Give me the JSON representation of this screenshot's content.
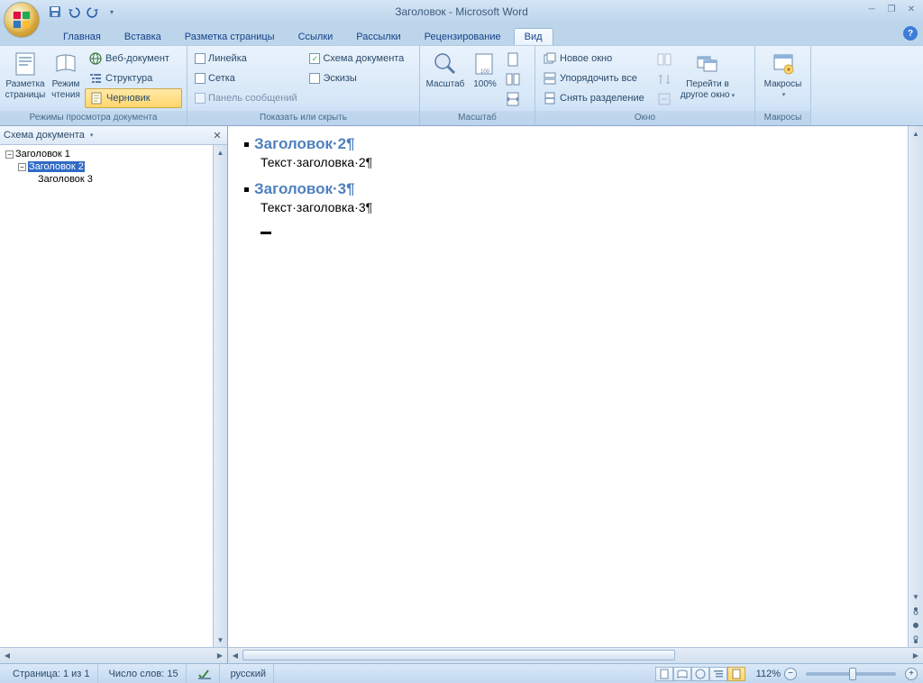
{
  "title": "Заголовок - Microsoft Word",
  "tabs": {
    "home": "Главная",
    "insert": "Вставка",
    "layout": "Разметка страницы",
    "refs": "Ссылки",
    "mail": "Рассылки",
    "review": "Рецензирование",
    "view": "Вид"
  },
  "ribbon": {
    "views_group": "Режимы просмотра документа",
    "print_layout1": "Разметка",
    "print_layout2": "страницы",
    "reading1": "Режим",
    "reading2": "чтения",
    "web": "Веб-документ",
    "outline": "Структура",
    "draft": "Черновик",
    "show_group": "Показать или скрыть",
    "ruler": "Линейка",
    "gridlines": "Сетка",
    "message_bar": "Панель сообщений",
    "doc_map": "Схема документа",
    "thumbnails": "Эскизы",
    "zoom_group": "Масштаб",
    "zoom": "Масштаб",
    "hundred": "100%",
    "window_group": "Окно",
    "new_window": "Новое окно",
    "arrange": "Упорядочить все",
    "split": "Снять разделение",
    "switch1": "Перейти в",
    "switch2": "другое окно",
    "macros_group": "Макросы",
    "macros": "Макросы"
  },
  "outline": {
    "title": "Схема документа",
    "items": {
      "h1": "Заголовок 1",
      "h2": "Заголовок 2",
      "h3": "Заголовок 3"
    }
  },
  "document": {
    "heading2": "Заголовок·2¶",
    "text2": "Текст·заголовка·2¶",
    "heading3": "Заголовок·3¶",
    "text3": "Текст·заголовка·3¶"
  },
  "status": {
    "page": "Страница: 1 из 1",
    "words": "Число слов: 15",
    "lang": "русский",
    "zoom": "112%"
  }
}
